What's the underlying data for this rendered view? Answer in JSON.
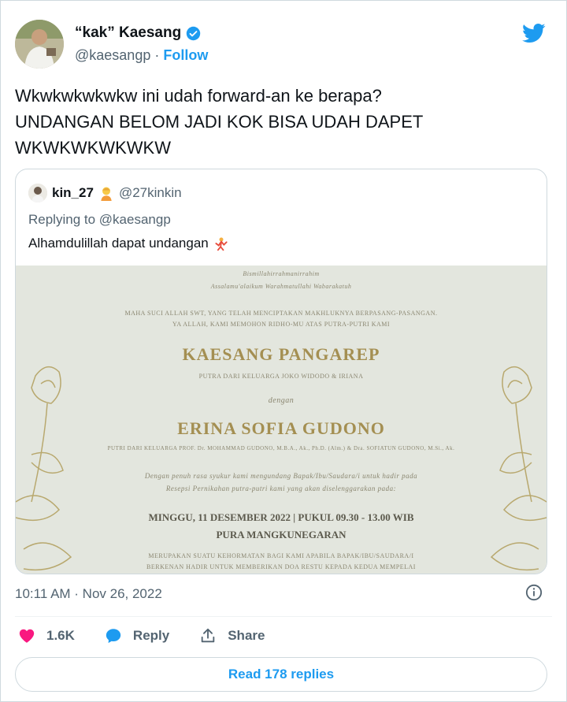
{
  "author": {
    "display_name": "“kak” Kaesang",
    "handle": "@kaesangp",
    "separator": "·",
    "follow_label": "Follow"
  },
  "tweet": {
    "lines": [
      "Wkwkwkwkwkw ini udah forward-an ke berapa?",
      "UNDANGAN BELOM JADI KOK BISA UDAH DAPET",
      "WKWKWKWKWKW"
    ],
    "timestamp": "10:11 AM · Nov 26, 2022"
  },
  "quoted": {
    "name": "kin_27",
    "handle": "@27kinkin",
    "replying_prefix": "Replying to",
    "replying_to": "@kaesangp",
    "text": "Alhamdulillah dapat undangan",
    "image_text": {
      "line1": "Bismillahirrahmanirrahim",
      "line2": "Assalamu'alaikum Warahmatullahi Wabarakatuh",
      "line3": "MAHA SUCI ALLAH SWT, YANG TELAH MENCIPTAKAN MAKHLUKNYA BERPASANG-PASANGAN.",
      "line4": "YA ALLAH, KAMI MEMOHON RIDHO-MU ATAS PUTRA-PUTRI KAMI",
      "groom": "KAESANG PANGAREP",
      "groom_parents": "PUTRA DARI KELUARGA JOKO WIDODO & IRIANA",
      "conj": "dengan",
      "bride": "ERINA SOFIA GUDONO",
      "bride_parents": "PUTRI DARI KELUARGA PROF. Dr. MOHAMMAD GUDONO, M.B.A., Ak., Ph.D. (Alm.) & Dra. SOFIATUN GUDONO, M.Si., Ak.",
      "invite1": "Dengan penuh rasa syukur kami mengundang Bapak/Ibu/Saudara/i untuk hadir pada",
      "invite2": "Resepsi Pernikahan putra-putri kami yang akan diselenggarakan pada:",
      "date_line": "MINGGU, 11 DESEMBER 2022 | PUKUL 09.30 - 13.00 WIB",
      "venue": "PURA MANGKUNEGARAN",
      "closing1": "MERUPAKAN SUATU KEHORMATAN BAGI KAMI APABILA BAPAK/IBU/SAUDARA/I",
      "closing2": "BERKENAN HADIR UNTUK MEMBERIKAN DOA RESTU KEPADA KEDUA MEMPELAI"
    }
  },
  "actions": {
    "likes": "1.6K",
    "reply_label": "Reply",
    "share_label": "Share"
  },
  "read_replies_label": "Read 178 replies",
  "colors": {
    "accent": "#1d9bf0",
    "like": "#f91880",
    "text_secondary": "#536471",
    "border": "#cfd9de"
  }
}
